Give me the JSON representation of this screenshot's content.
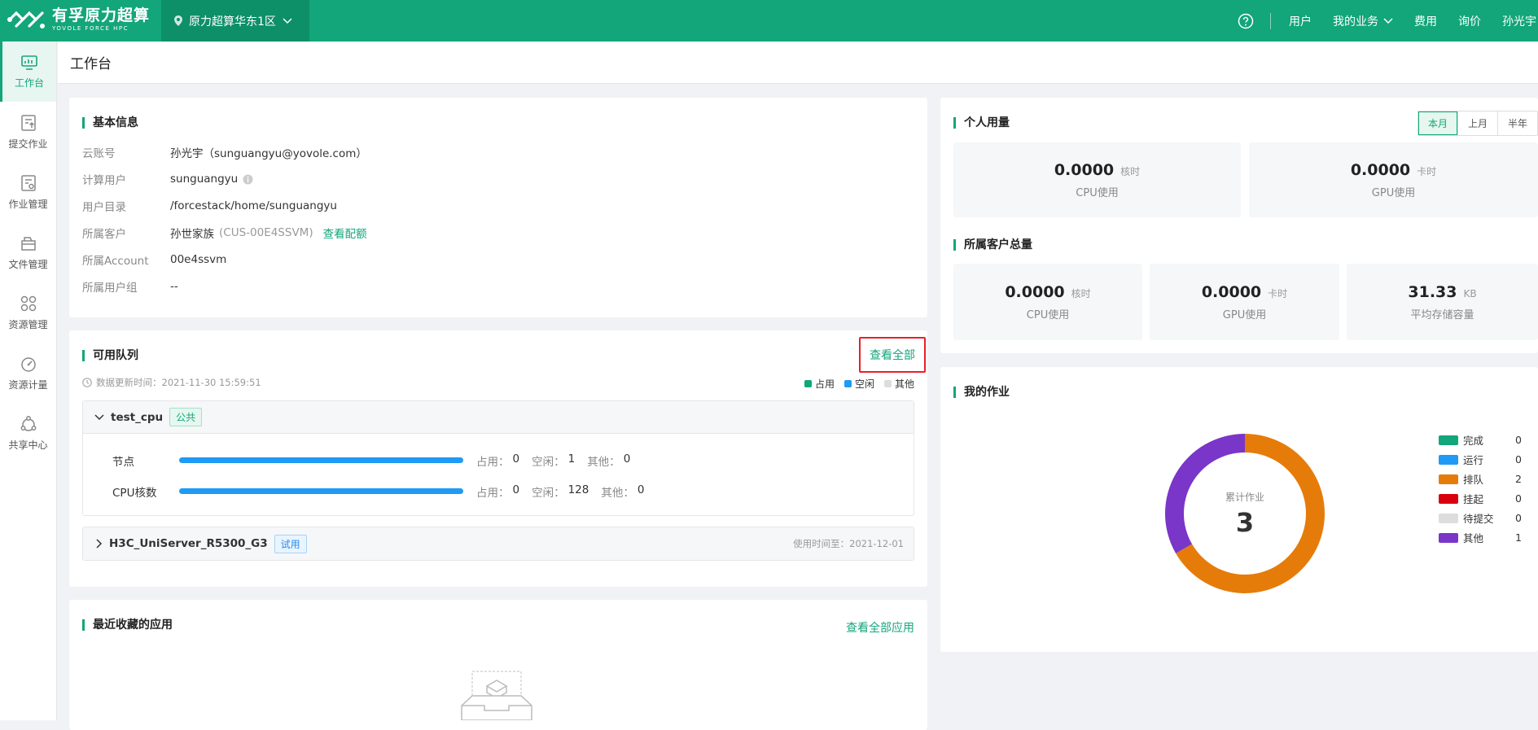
{
  "header": {
    "logo_cn": "有孚原力超算",
    "logo_en": "YOVOLE FORCE HPC",
    "region": "原力超算华东1区",
    "nav": [
      "用户",
      "我的业务",
      "费用",
      "询价",
      "孙光宇"
    ]
  },
  "sidebar": {
    "items": [
      {
        "label": "工作台",
        "icon": "monitor-icon"
      },
      {
        "label": "提交作业",
        "icon": "upload-doc-icon"
      },
      {
        "label": "作业管理",
        "icon": "doc-gear-icon"
      },
      {
        "label": "文件管理",
        "icon": "folder-icon"
      },
      {
        "label": "资源管理",
        "icon": "grid-circles-icon"
      },
      {
        "label": "资源计量",
        "icon": "gauge-icon"
      },
      {
        "label": "共享中心",
        "icon": "share-icon"
      }
    ]
  },
  "page_title": "工作台",
  "basic_info": {
    "title": "基本信息",
    "rows": [
      {
        "key": "云账号",
        "value": "孙光宇（sunguangyu@yovole.com）"
      },
      {
        "key": "计算用户",
        "value": "sunguangyu"
      },
      {
        "key": "用户目录",
        "value": "/forcestack/home/sunguangyu"
      },
      {
        "key": "所属客户",
        "value": "孙世家族",
        "extra": "(CUS-00E4SSVM)",
        "link": "查看配额"
      },
      {
        "key": "所属Account",
        "value": "00e4ssvm"
      },
      {
        "key": "所属用户组",
        "value": "--"
      }
    ]
  },
  "queues": {
    "title": "可用队列",
    "view_all": "查看全部",
    "updated": "数据更新时间：2021-11-30 15:59:51",
    "legend": [
      "占用",
      "空闲",
      "其他"
    ],
    "legend_colors": [
      "#12a67a",
      "#1f9af5",
      "#dddddd"
    ],
    "q1": {
      "name": "test_cpu",
      "tag": "公共",
      "rows": [
        {
          "label": "节点",
          "used_label": "占用：",
          "used": "0",
          "idle_label": "空闲：",
          "idle": "1",
          "other_label": "其他：",
          "other": "0"
        },
        {
          "label": "CPU核数",
          "used_label": "占用：",
          "used": "0",
          "idle_label": "空闲：",
          "idle": "128",
          "other_label": "其他：",
          "other": "0"
        }
      ]
    },
    "q2": {
      "name": "H3C_UniServer_R5300_G3",
      "tag": "试用",
      "expire": "使用时间至：2021-12-01"
    }
  },
  "recent_apps": {
    "title": "最近收藏的应用",
    "view_all": "查看全部应用"
  },
  "personal_usage": {
    "title": "个人用量",
    "tabs": [
      "本月",
      "上月",
      "半年"
    ],
    "cpu": {
      "value": "0.0000",
      "unit": "核时",
      "label": "CPU使用"
    },
    "gpu": {
      "value": "0.0000",
      "unit": "卡时",
      "label": "GPU使用"
    }
  },
  "customer_total": {
    "title": "所属客户总量",
    "cpu": {
      "value": "0.0000",
      "unit": "核时",
      "label": "CPU使用"
    },
    "gpu": {
      "value": "0.0000",
      "unit": "卡时",
      "label": "GPU使用"
    },
    "storage": {
      "value": "31.33",
      "unit": "KB",
      "label": "平均存储容量"
    }
  },
  "my_jobs": {
    "title": "我的作业",
    "center_label": "累计作业",
    "total": "3",
    "legend": [
      {
        "name": "完成",
        "count": "0",
        "color": "#12a67a"
      },
      {
        "name": "运行",
        "count": "0",
        "color": "#1f9af5"
      },
      {
        "name": "排队",
        "count": "2",
        "color": "#e57c0a"
      },
      {
        "name": "挂起",
        "count": "0",
        "color": "#d9000d"
      },
      {
        "name": "待提交",
        "count": "0",
        "color": "#dddddd"
      },
      {
        "name": "其他",
        "count": "1",
        "color": "#7a35c9"
      }
    ]
  },
  "chart_data": {
    "type": "pie",
    "categories": [
      "完成",
      "运行",
      "排队",
      "挂起",
      "待提交",
      "其他"
    ],
    "values": [
      0,
      0,
      2,
      0,
      0,
      1
    ]
  }
}
